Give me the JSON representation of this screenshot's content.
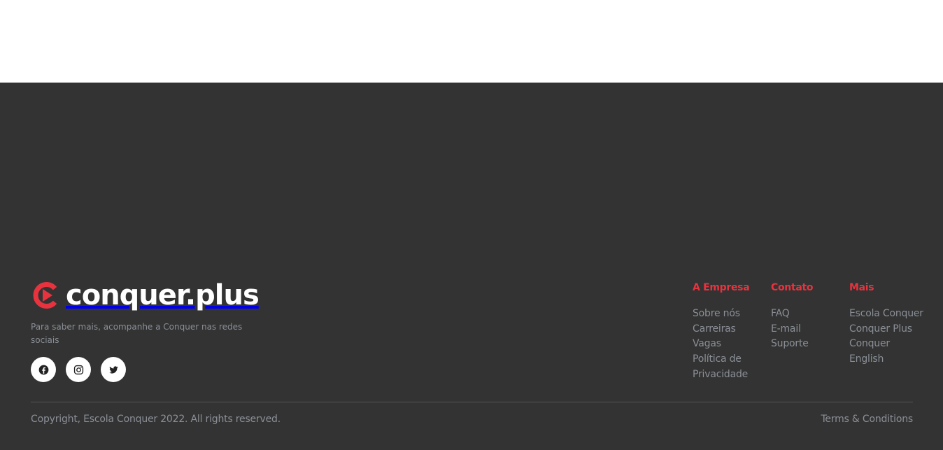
{
  "brand": {
    "logo_text": "conquer.plus",
    "accent_color": "#e8333f",
    "tagline": "Para saber mais, acompanhe a Conquer nas redes sociais"
  },
  "social": [
    {
      "icon": "facebook-icon"
    },
    {
      "icon": "instagram-icon"
    },
    {
      "icon": "twitter-icon"
    }
  ],
  "columns": [
    {
      "title": "A Empresa",
      "links": [
        "Sobre nós",
        "Carreiras",
        "Vagas",
        "Política de Privacidade"
      ]
    },
    {
      "title": "Contato",
      "links": [
        "FAQ",
        "E-mail",
        "Suporte"
      ]
    },
    {
      "title": "Mais",
      "links": [
        "Escola Conquer",
        "Conquer Plus",
        "Conquer English"
      ]
    }
  ],
  "bottom": {
    "copyright": "Copyright, Escola Conquer 2022. All rights reserved.",
    "terms": "Terms & Conditions"
  },
  "colors": {
    "footer_bg": "#333333",
    "text_muted": "#8a8f96"
  }
}
